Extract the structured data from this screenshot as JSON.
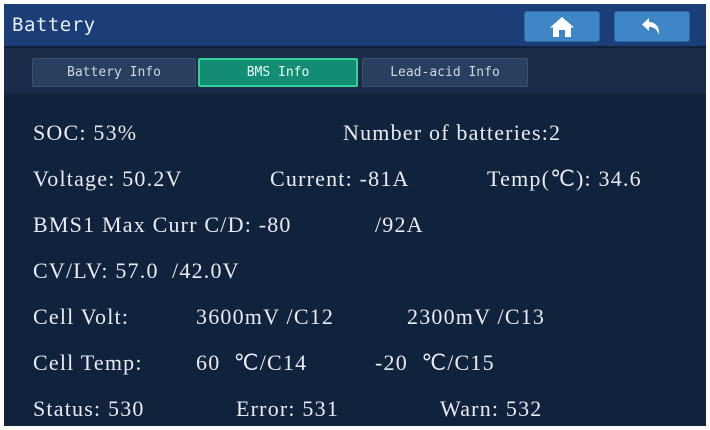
{
  "header": {
    "title": "Battery",
    "home_icon": "home-icon",
    "back_icon": "back-arrow-icon"
  },
  "tabs": [
    {
      "label": "Battery Info",
      "active": false
    },
    {
      "label": "BMS Info",
      "active": true
    },
    {
      "label": "Lead-acid Info",
      "active": false
    }
  ],
  "bms": {
    "soc": "SOC: 53%",
    "battery_count": "Number of batteries:2",
    "voltage": "Voltage: 50.2V",
    "current": "Current: -81A",
    "temp": "Temp(℃): 34.6",
    "max_curr_label": "BMS1 Max Curr C/D: -80",
    "max_curr_discharge": "/92A",
    "cv_lv": "CV/LV: 57.0  /42.0V",
    "cell_volt_label": "Cell Volt:",
    "cell_volt_max": "3600mV /C12",
    "cell_volt_min": "2300mV /C13",
    "cell_temp_label": "Cell Temp:",
    "cell_temp_max": "60  ℃/C14",
    "cell_temp_min": "-20  ℃/C15",
    "status": "Status: 530",
    "error": "Error: 531",
    "warn": "Warn: 532"
  },
  "colors": {
    "background": "#10223c",
    "titlebar": "#1b3d78",
    "tab_active": "#128d74",
    "nav_button": "#3e86c6",
    "text": "#e7ecf3"
  }
}
